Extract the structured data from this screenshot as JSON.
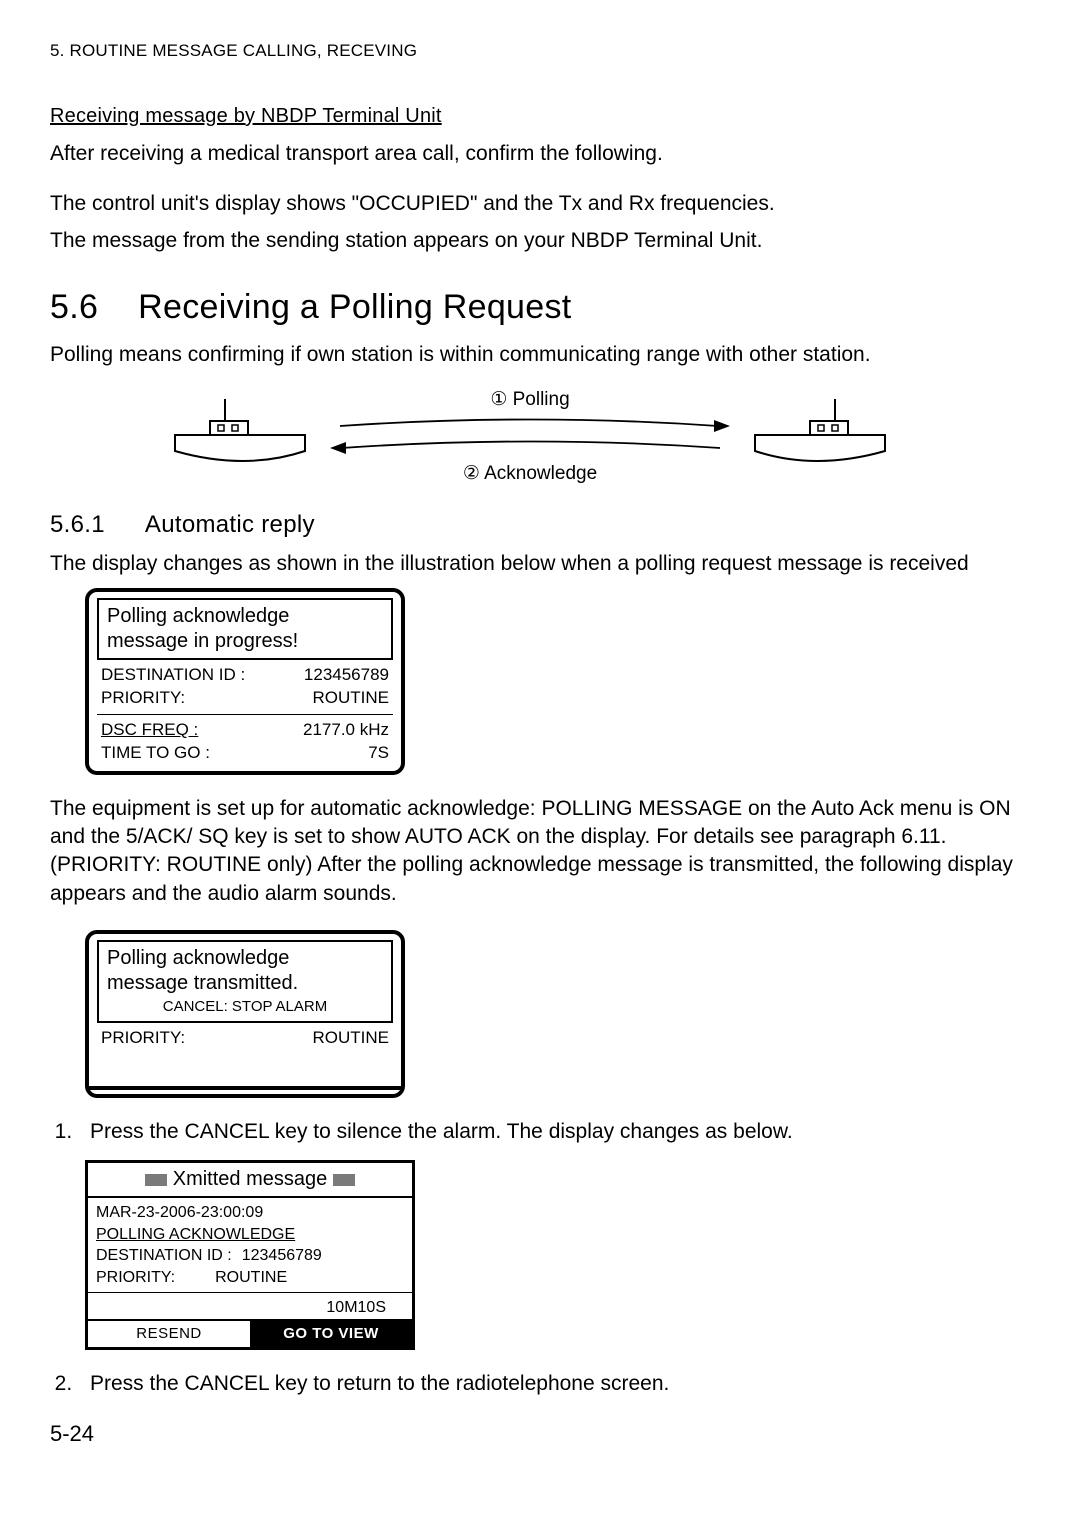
{
  "header": "5. ROUTINE MESSAGE CALLING, RECEVING",
  "recv_heading": "Receiving message by NBDP Terminal Unit",
  "recv_p1": "After receiving a medical transport area call, confirm the following.",
  "recv_p2": "The control unit's display shows \"OCCUPIED\" and the Tx and Rx frequencies.",
  "recv_p3": "The message from the sending station appears on your NBDP Terminal Unit.",
  "section": {
    "num": "5.6",
    "title": "Receiving a Polling Request",
    "intro": "Polling means confirming if own station is within communicating range with other station."
  },
  "diagram": {
    "top_label": "① Polling",
    "bottom_label": "② Acknowledge"
  },
  "subsection": {
    "num": "5.6.1",
    "title": "Automatic reply",
    "intro": "The display changes as shown in the illustration below when a polling request message is received"
  },
  "panel1": {
    "title_line1": "Polling acknowledge",
    "title_line2": "message in progress!",
    "dest_label": "DESTINATION ID :",
    "dest_value": "123456789",
    "priority_label": "PRIORITY:",
    "priority_value": "ROUTINE",
    "dsc_label": "DSC FREQ   :",
    "dsc_value": "2177.0 kHz",
    "ttg_label": "TIME TO GO :",
    "ttg_value": "7S"
  },
  "after_panel1": "The equipment is set up for automatic acknowledge: POLLING MESSAGE on the Auto Ack menu is ON and the 5/ACK/ SQ key is set to show AUTO ACK on the display. For details see paragraph 6.11. (PRIORITY: ROUTINE only) After the polling acknowledge message is transmitted, the following display appears and the audio alarm sounds.",
  "panel2": {
    "title_line1": "Polling acknowledge",
    "title_line2": "message transmitted.",
    "cancel_line": "CANCEL: STOP ALARM",
    "priority_label": "PRIORITY:",
    "priority_value": "ROUTINE"
  },
  "step1": "Press the CANCEL key to silence the alarm. The display changes as below.",
  "panel3": {
    "header": "Xmitted message",
    "timestamp": "MAR-23-2006-23:00:09",
    "type": "POLLING  ACKNOWLEDGE",
    "dest_label": "DESTINATION ID :",
    "dest_value": "123456789",
    "priority_label": "PRIORITY:",
    "priority_value": "ROUTINE",
    "time_elapsed": "10M10S",
    "btn_resend": "RESEND",
    "btn_goto": "GO TO VIEW"
  },
  "step2": "Press the CANCEL key to return to the radiotelephone screen.",
  "page_number": "5-24"
}
